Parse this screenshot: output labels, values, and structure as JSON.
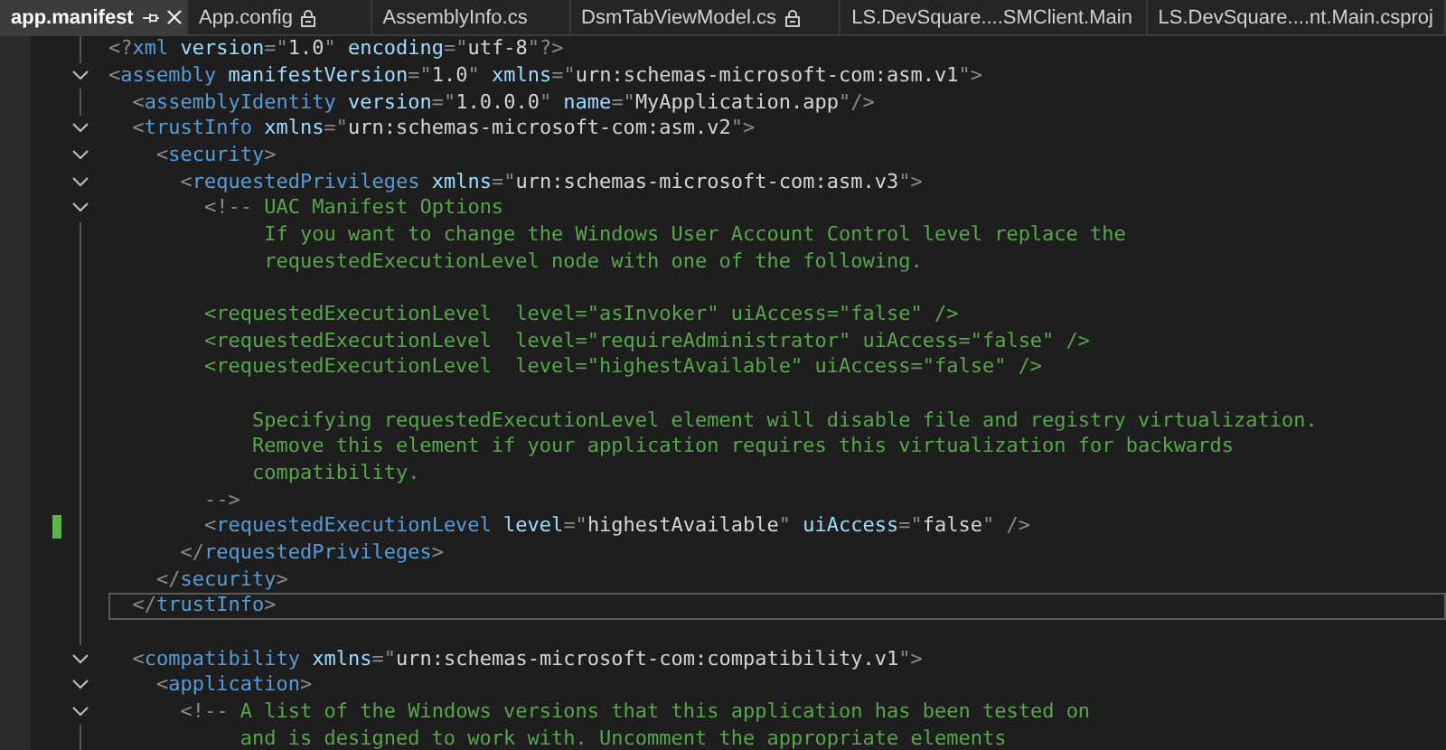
{
  "tabs": [
    {
      "label": "app.manifest",
      "selected": true,
      "pinned": true,
      "locked": false,
      "closable": true
    },
    {
      "label": "App.config",
      "selected": false,
      "pinned": false,
      "locked": true,
      "closable": false
    },
    {
      "label": "AssemblyInfo.cs",
      "selected": false,
      "pinned": false,
      "locked": false,
      "closable": false
    },
    {
      "label": "DsmTabViewModel.cs",
      "selected": false,
      "pinned": false,
      "locked": true,
      "closable": false
    },
    {
      "label": "LS.DevSquare....SMClient.Main",
      "selected": false,
      "pinned": false,
      "locked": false,
      "closable": false
    },
    {
      "label": "LS.DevSquare....nt.Main.csproj",
      "selected": false,
      "pinned": false,
      "locked": false,
      "closable": false
    }
  ],
  "editor": {
    "lines": [
      {
        "foldable": false,
        "current": false,
        "changed": false,
        "tokens": [
          {
            "kind": "punct",
            "text": "<?"
          },
          {
            "kind": "tag",
            "text": "xml"
          },
          {
            "kind": "attr",
            "text": " version"
          },
          {
            "kind": "punct",
            "text": "=\""
          },
          {
            "kind": "value",
            "text": "1.0"
          },
          {
            "kind": "punct",
            "text": "\""
          },
          {
            "kind": "attr",
            "text": " encoding"
          },
          {
            "kind": "punct",
            "text": "=\""
          },
          {
            "kind": "value",
            "text": "utf-8"
          },
          {
            "kind": "punct",
            "text": "\"?>"
          }
        ]
      },
      {
        "foldable": true,
        "current": false,
        "changed": false,
        "tokens": [
          {
            "kind": "punct",
            "text": "<"
          },
          {
            "kind": "tag",
            "text": "assembly"
          },
          {
            "kind": "attr",
            "text": " manifestVersion"
          },
          {
            "kind": "punct",
            "text": "=\""
          },
          {
            "kind": "value",
            "text": "1.0"
          },
          {
            "kind": "punct",
            "text": "\""
          },
          {
            "kind": "attr",
            "text": " xmlns"
          },
          {
            "kind": "punct",
            "text": "=\""
          },
          {
            "kind": "value",
            "text": "urn:schemas-microsoft-com:asm.v1"
          },
          {
            "kind": "punct",
            "text": "\">"
          }
        ]
      },
      {
        "foldable": false,
        "current": false,
        "changed": false,
        "tokens": [
          {
            "kind": "punct",
            "text": "  <"
          },
          {
            "kind": "tag",
            "text": "assemblyIdentity"
          },
          {
            "kind": "attr",
            "text": " version"
          },
          {
            "kind": "punct",
            "text": "=\""
          },
          {
            "kind": "value",
            "text": "1.0.0.0"
          },
          {
            "kind": "punct",
            "text": "\""
          },
          {
            "kind": "attr",
            "text": " name"
          },
          {
            "kind": "punct",
            "text": "=\""
          },
          {
            "kind": "value",
            "text": "MyApplication.app"
          },
          {
            "kind": "punct",
            "text": "\"/>"
          }
        ]
      },
      {
        "foldable": true,
        "current": false,
        "changed": false,
        "tokens": [
          {
            "kind": "punct",
            "text": "  <"
          },
          {
            "kind": "tag",
            "text": "trustInfo"
          },
          {
            "kind": "attr",
            "text": " xmlns"
          },
          {
            "kind": "punct",
            "text": "=\""
          },
          {
            "kind": "value",
            "text": "urn:schemas-microsoft-com:asm.v2"
          },
          {
            "kind": "punct",
            "text": "\">"
          }
        ]
      },
      {
        "foldable": true,
        "current": false,
        "changed": false,
        "tokens": [
          {
            "kind": "punct",
            "text": "    <"
          },
          {
            "kind": "tag",
            "text": "security"
          },
          {
            "kind": "punct",
            "text": ">"
          }
        ]
      },
      {
        "foldable": true,
        "current": false,
        "changed": false,
        "tokens": [
          {
            "kind": "punct",
            "text": "      <"
          },
          {
            "kind": "tag",
            "text": "requestedPrivileges"
          },
          {
            "kind": "attr",
            "text": " xmlns"
          },
          {
            "kind": "punct",
            "text": "=\""
          },
          {
            "kind": "value",
            "text": "urn:schemas-microsoft-com:asm.v3"
          },
          {
            "kind": "punct",
            "text": "\">"
          }
        ]
      },
      {
        "foldable": true,
        "current": false,
        "changed": false,
        "tokens": [
          {
            "kind": "punct",
            "text": "        <!--"
          },
          {
            "kind": "comment",
            "text": " UAC Manifest Options"
          }
        ]
      },
      {
        "foldable": false,
        "current": false,
        "changed": false,
        "tokens": [
          {
            "kind": "comment",
            "text": "             If you want to change the Windows User Account Control level replace the"
          }
        ]
      },
      {
        "foldable": false,
        "current": false,
        "changed": false,
        "tokens": [
          {
            "kind": "comment",
            "text": "             requestedExecutionLevel node with one of the following."
          }
        ]
      },
      {
        "foldable": false,
        "current": false,
        "changed": false
      },
      {
        "foldable": false,
        "current": false,
        "changed": false,
        "tokens": [
          {
            "kind": "comment",
            "text": "        <requestedExecutionLevel  level=\"asInvoker\" uiAccess=\"false\" />"
          }
        ]
      },
      {
        "foldable": false,
        "current": false,
        "changed": false,
        "tokens": [
          {
            "kind": "comment",
            "text": "        <requestedExecutionLevel  level=\"requireAdministrator\" uiAccess=\"false\" />"
          }
        ]
      },
      {
        "foldable": false,
        "current": false,
        "changed": false,
        "tokens": [
          {
            "kind": "comment",
            "text": "        <requestedExecutionLevel  level=\"highestAvailable\" uiAccess=\"false\" />"
          }
        ]
      },
      {
        "foldable": false,
        "current": false,
        "changed": false
      },
      {
        "foldable": false,
        "current": false,
        "changed": false,
        "tokens": [
          {
            "kind": "comment",
            "text": "            Specifying requestedExecutionLevel element will disable file and registry virtualization."
          }
        ]
      },
      {
        "foldable": false,
        "current": false,
        "changed": false,
        "tokens": [
          {
            "kind": "comment",
            "text": "            Remove this element if your application requires this virtualization for backwards"
          }
        ]
      },
      {
        "foldable": false,
        "current": false,
        "changed": false,
        "tokens": [
          {
            "kind": "comment",
            "text": "            compatibility."
          }
        ]
      },
      {
        "foldable": false,
        "current": false,
        "changed": false,
        "tokens": [
          {
            "kind": "punct",
            "text": "        -->"
          }
        ]
      },
      {
        "foldable": false,
        "current": false,
        "changed": true,
        "tokens": [
          {
            "kind": "punct",
            "text": "        <"
          },
          {
            "kind": "tag",
            "text": "requestedExecutionLevel"
          },
          {
            "kind": "attr",
            "text": " level"
          },
          {
            "kind": "punct",
            "text": "=\""
          },
          {
            "kind": "value",
            "text": "highestAvailable"
          },
          {
            "kind": "punct",
            "text": "\""
          },
          {
            "kind": "attr",
            "text": " uiAccess"
          },
          {
            "kind": "punct",
            "text": "=\""
          },
          {
            "kind": "value",
            "text": "false"
          },
          {
            "kind": "punct",
            "text": "\" />"
          }
        ]
      },
      {
        "foldable": false,
        "current": false,
        "changed": false,
        "tokens": [
          {
            "kind": "punct",
            "text": "      </"
          },
          {
            "kind": "tag",
            "text": "requestedPrivileges"
          },
          {
            "kind": "punct",
            "text": ">"
          }
        ]
      },
      {
        "foldable": false,
        "current": false,
        "changed": false,
        "tokens": [
          {
            "kind": "punct",
            "text": "    </"
          },
          {
            "kind": "tag",
            "text": "security"
          },
          {
            "kind": "punct",
            "text": ">"
          }
        ]
      },
      {
        "foldable": false,
        "current": true,
        "changed": false,
        "tokens": [
          {
            "kind": "punct",
            "text": "  </"
          },
          {
            "kind": "tag",
            "text": "trustInfo"
          },
          {
            "kind": "punct",
            "text": ">"
          }
        ]
      },
      {
        "foldable": false,
        "current": false,
        "changed": false
      },
      {
        "foldable": true,
        "current": false,
        "changed": false,
        "tokens": [
          {
            "kind": "punct",
            "text": "  <"
          },
          {
            "kind": "tag",
            "text": "compatibility"
          },
          {
            "kind": "attr",
            "text": " xmlns"
          },
          {
            "kind": "punct",
            "text": "=\""
          },
          {
            "kind": "value",
            "text": "urn:schemas-microsoft-com:compatibility.v1"
          },
          {
            "kind": "punct",
            "text": "\">"
          }
        ]
      },
      {
        "foldable": true,
        "current": false,
        "changed": false,
        "tokens": [
          {
            "kind": "punct",
            "text": "    <"
          },
          {
            "kind": "tag",
            "text": "application"
          },
          {
            "kind": "punct",
            "text": ">"
          }
        ]
      },
      {
        "foldable": true,
        "current": false,
        "changed": false,
        "tokens": [
          {
            "kind": "punct",
            "text": "      <!--"
          },
          {
            "kind": "comment",
            "text": " A list of the Windows versions that this application has been tested on"
          }
        ]
      },
      {
        "foldable": false,
        "current": false,
        "changed": false,
        "tokens": [
          {
            "kind": "comment",
            "text": "           and is designed to work with. Uncomment the appropriate elements"
          }
        ]
      }
    ]
  }
}
